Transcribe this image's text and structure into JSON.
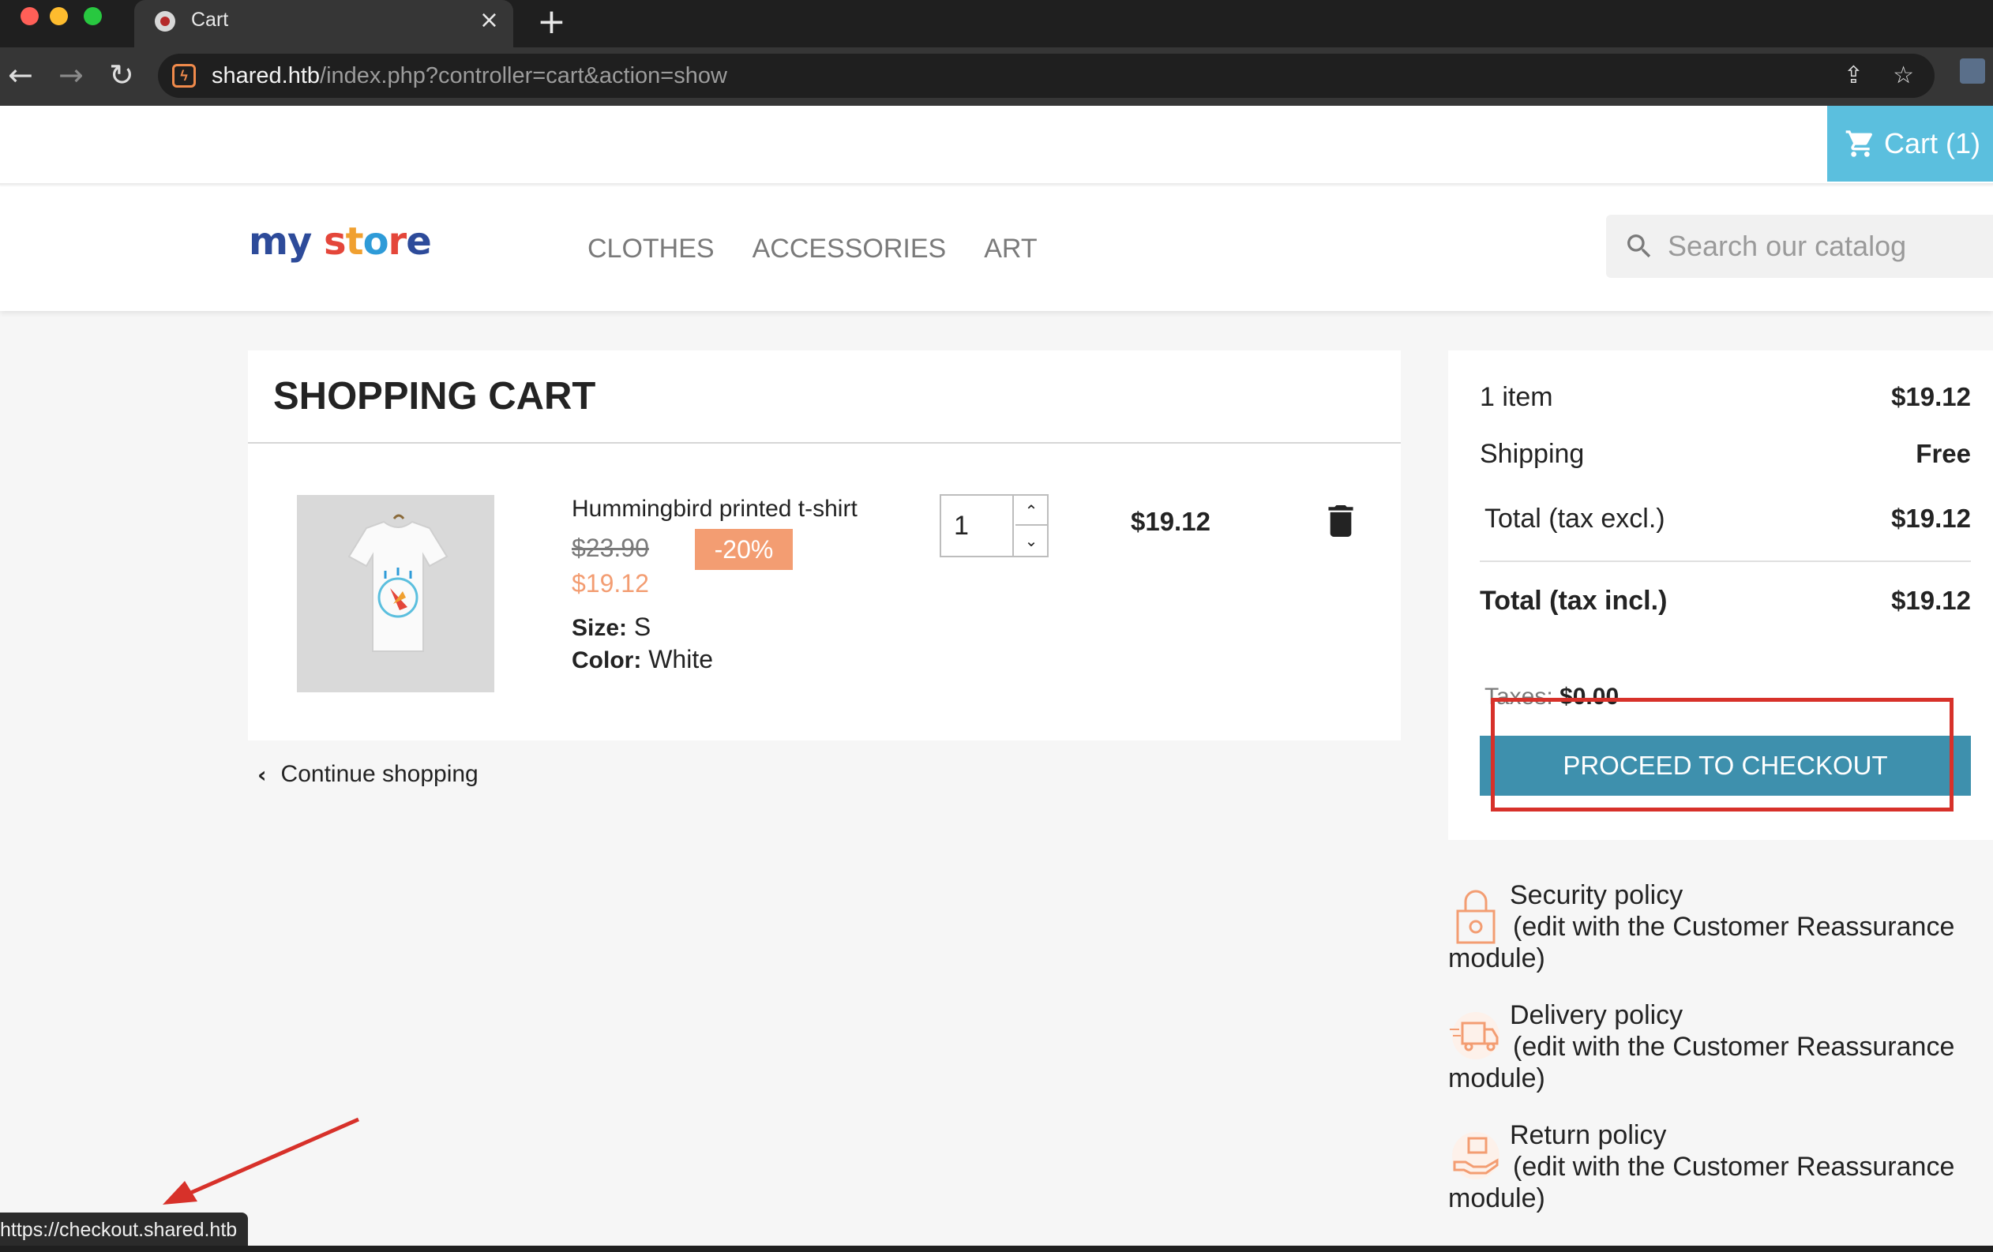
{
  "browser": {
    "tab_title": "Cart",
    "tab_close": "×",
    "new_tab": "+",
    "url_host": "shared.htb",
    "url_path": "/index.php?controller=cart&action=show",
    "status_url": "https://checkout.shared.htb"
  },
  "header": {
    "cart_label": "Cart (1)",
    "logo": {
      "my": "my",
      "store_letters": [
        "s",
        "t",
        "o",
        "r",
        "e"
      ]
    },
    "menu": [
      "CLOTHES",
      "ACCESSORIES",
      "ART"
    ],
    "search_placeholder": "Search our catalog"
  },
  "cart": {
    "title": "SHOPPING CART",
    "product": {
      "name": "Hummingbird printed t-shirt",
      "old_price": "$23.90",
      "discount": "-20%",
      "price": "$19.12",
      "size_label": "Size:",
      "size_value": "S",
      "color_label": "Color:",
      "color_value": "White",
      "quantity": "1",
      "line_total": "$19.12"
    },
    "continue_label": "Continue shopping"
  },
  "summary": {
    "items_label": "1 item",
    "items_value": "$19.12",
    "shipping_label": "Shipping",
    "shipping_value": "Free",
    "total_excl_label": "Total (tax excl.)",
    "total_excl_value": "$19.12",
    "total_incl_label": "Total (tax incl.)",
    "total_incl_value": "$19.12",
    "taxes_label": "Taxes:",
    "taxes_value": "$0.00",
    "checkout_label": "PROCEED TO CHECKOUT"
  },
  "reassurance": [
    {
      "title": "Security policy",
      "desc": "(edit with the Customer Reassurance",
      "tail": "module)",
      "icon": "lock-icon"
    },
    {
      "title": "Delivery policy",
      "desc": "(edit with the Customer Reassurance",
      "tail": "module)",
      "icon": "truck-icon"
    },
    {
      "title": "Return policy",
      "desc": "(edit with the Customer Reassurance",
      "tail": "module)",
      "icon": "return-hand-icon"
    }
  ],
  "colors": {
    "cart_button": "#5bbfde",
    "checkout_button": "#3e90ad",
    "discount": "#f39d72",
    "annotation": "#d7312a"
  }
}
